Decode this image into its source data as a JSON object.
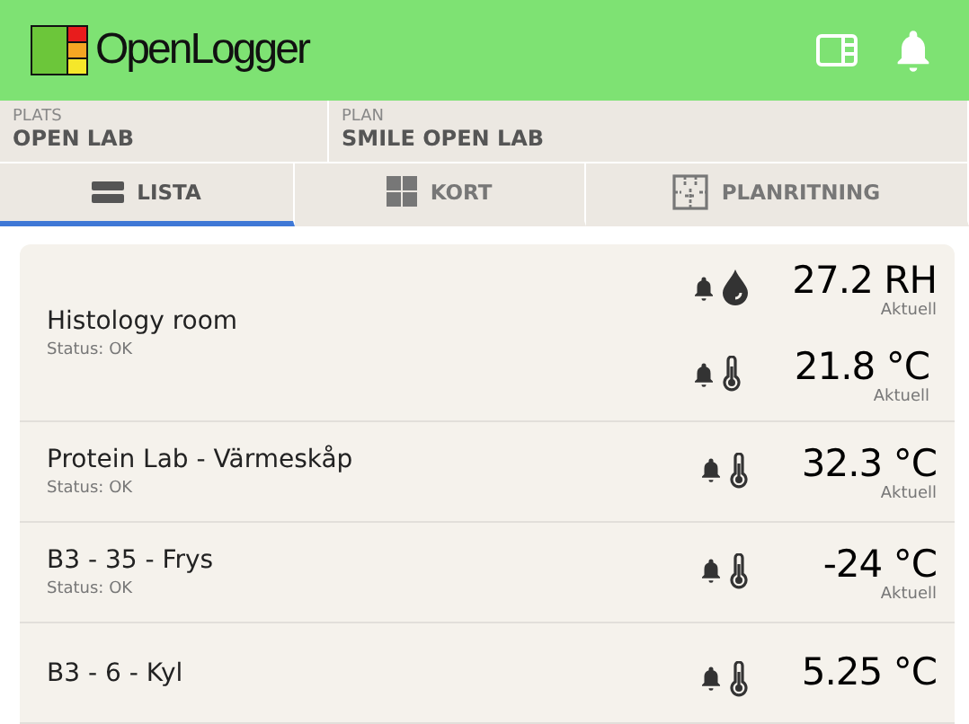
{
  "header": {
    "logo_text": "OpenLogger"
  },
  "context": [
    {
      "label": "PLATS",
      "value": "OPEN LAB"
    },
    {
      "label": "PLAN",
      "value": "SMILE OPEN LAB"
    }
  ],
  "tabs": [
    {
      "label": "LISTA",
      "kind": "list",
      "selected": true
    },
    {
      "label": "KORT",
      "kind": "grid",
      "selected": false
    },
    {
      "label": "PLANRITNING",
      "kind": "plan",
      "selected": false
    }
  ],
  "rows": [
    {
      "name": "Histology room",
      "status": "Status: OK",
      "readings": [
        {
          "kind": "humidity",
          "value": "27.2 RH",
          "caption": "Aktuell"
        },
        {
          "kind": "temperature",
          "value": "21.8 °C",
          "caption": "Aktuell"
        }
      ]
    },
    {
      "name": "Protein Lab - Värmeskåp",
      "status": "Status: OK",
      "readings": [
        {
          "kind": "temperature",
          "value": "32.3 °C",
          "caption": "Aktuell"
        }
      ]
    },
    {
      "name": "B3 - 35 - Frys",
      "status": "Status: OK",
      "readings": [
        {
          "kind": "temperature",
          "value": "-24 °C",
          "caption": "Aktuell"
        }
      ]
    },
    {
      "name": "B3 - 6 - Kyl",
      "readings": [
        {
          "kind": "temperature",
          "value": "5.25 °C"
        }
      ]
    }
  ]
}
